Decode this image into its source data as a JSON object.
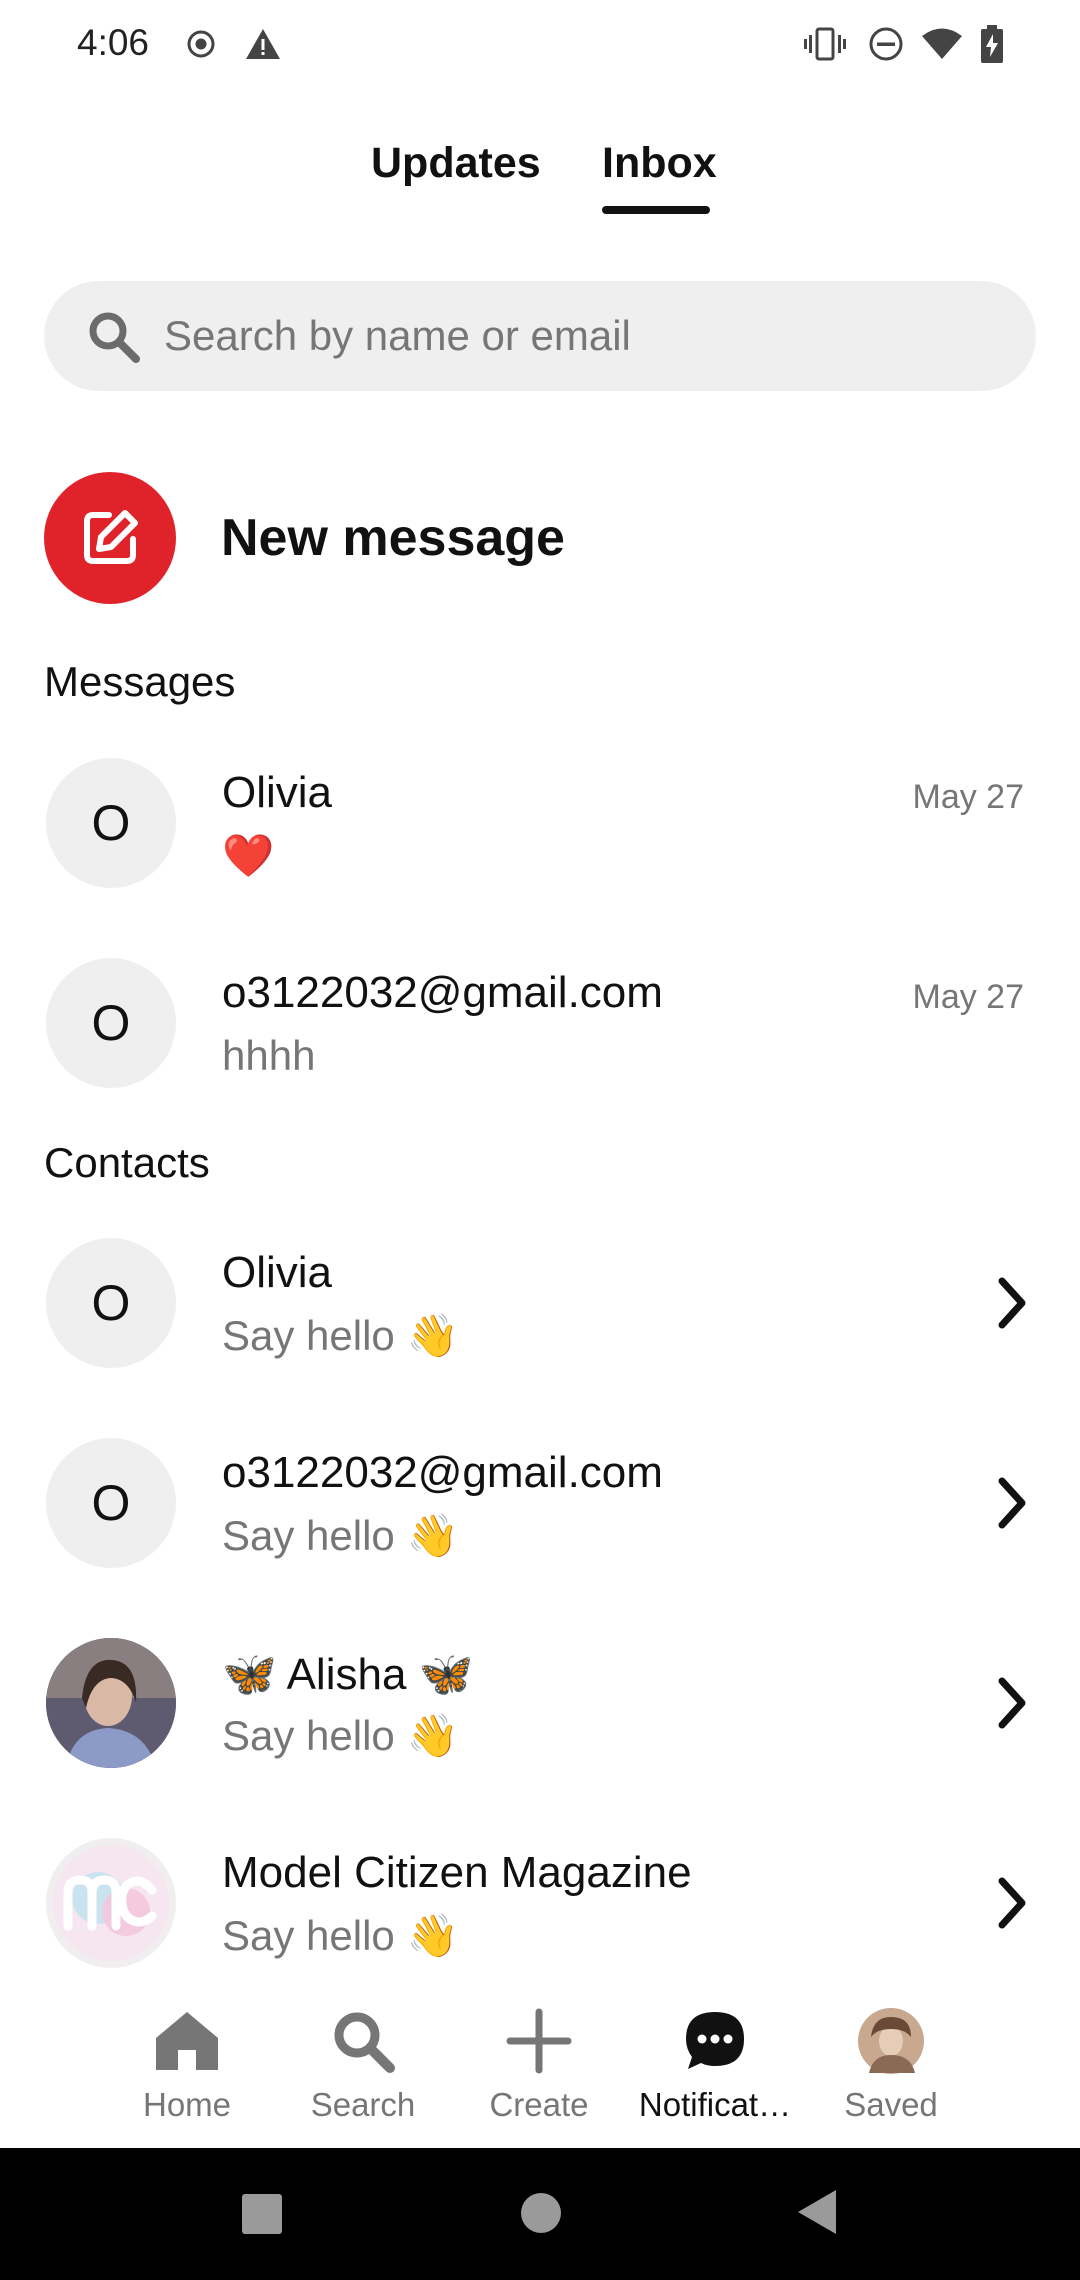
{
  "status_bar": {
    "time": "4:06"
  },
  "tabs": [
    {
      "label": "Updates",
      "active": false
    },
    {
      "label": "Inbox",
      "active": true
    }
  ],
  "search": {
    "placeholder": "Search by name or email",
    "value": ""
  },
  "new_message": {
    "label": "New message"
  },
  "messages": {
    "header": "Messages",
    "items": [
      {
        "initial": "O",
        "name": "Olivia",
        "preview": "❤️",
        "date": "May 27"
      },
      {
        "initial": "O",
        "name": "o3122032@gmail.com",
        "preview": "hhhh",
        "date": "May 27"
      }
    ]
  },
  "contacts": {
    "header": "Contacts",
    "items": [
      {
        "initial": "O",
        "name": "Olivia",
        "sub": "Say hello 👋"
      },
      {
        "initial": "O",
        "name": "o3122032@gmail.com",
        "sub": "Say hello 👋"
      },
      {
        "initial": "",
        "name": "🦋 Alisha 🦋",
        "sub": "Say hello 👋"
      },
      {
        "initial": "",
        "name": "Model Citizen Magazine",
        "sub": "Say hello 👋"
      }
    ]
  },
  "bottom_nav": [
    {
      "label": "Home",
      "icon": "home-icon",
      "active": false
    },
    {
      "label": "Search",
      "icon": "search-icon",
      "active": false
    },
    {
      "label": "Create",
      "icon": "plus-icon",
      "active": false
    },
    {
      "label": "Notificat…",
      "icon": "chat-bubble-icon",
      "active": true
    },
    {
      "label": "Saved",
      "icon": "profile-avatar",
      "active": false
    }
  ],
  "colors": {
    "accent": "#e0232b",
    "text_primary": "#111111",
    "text_secondary": "#767676",
    "surface": "#efefef"
  }
}
